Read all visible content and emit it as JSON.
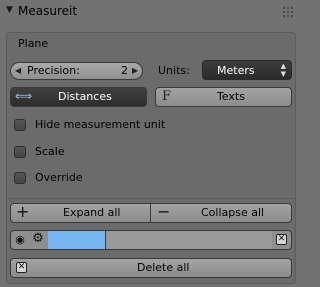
{
  "panel": {
    "title": "Measureit"
  },
  "plane": {
    "heading": "Plane",
    "precision_label": "Precision:",
    "precision_value": "2",
    "units_label": "Units:",
    "units_value": "Meters",
    "distances_label": "Distances",
    "texts_label": "Texts"
  },
  "options": [
    {
      "label": "Hide measurement unit",
      "checked": false
    },
    {
      "label": "Scale",
      "checked": false
    },
    {
      "label": "Override",
      "checked": false
    }
  ],
  "bottom": {
    "expand_label": "Expand all",
    "collapse_label": "Collapse all",
    "delete_label": "Delete all"
  },
  "colors": {
    "accent_field": "#79b7f2",
    "panel_bg": "#727272",
    "dark_button": "#333333"
  },
  "icons": [
    "disclosure-triangle-icon",
    "drag-grip-icon",
    "arrows-horizontal-icon",
    "text-font-icon",
    "plus-icon",
    "minus-icon",
    "eye-icon",
    "gear-icon",
    "close-x-icon"
  ]
}
